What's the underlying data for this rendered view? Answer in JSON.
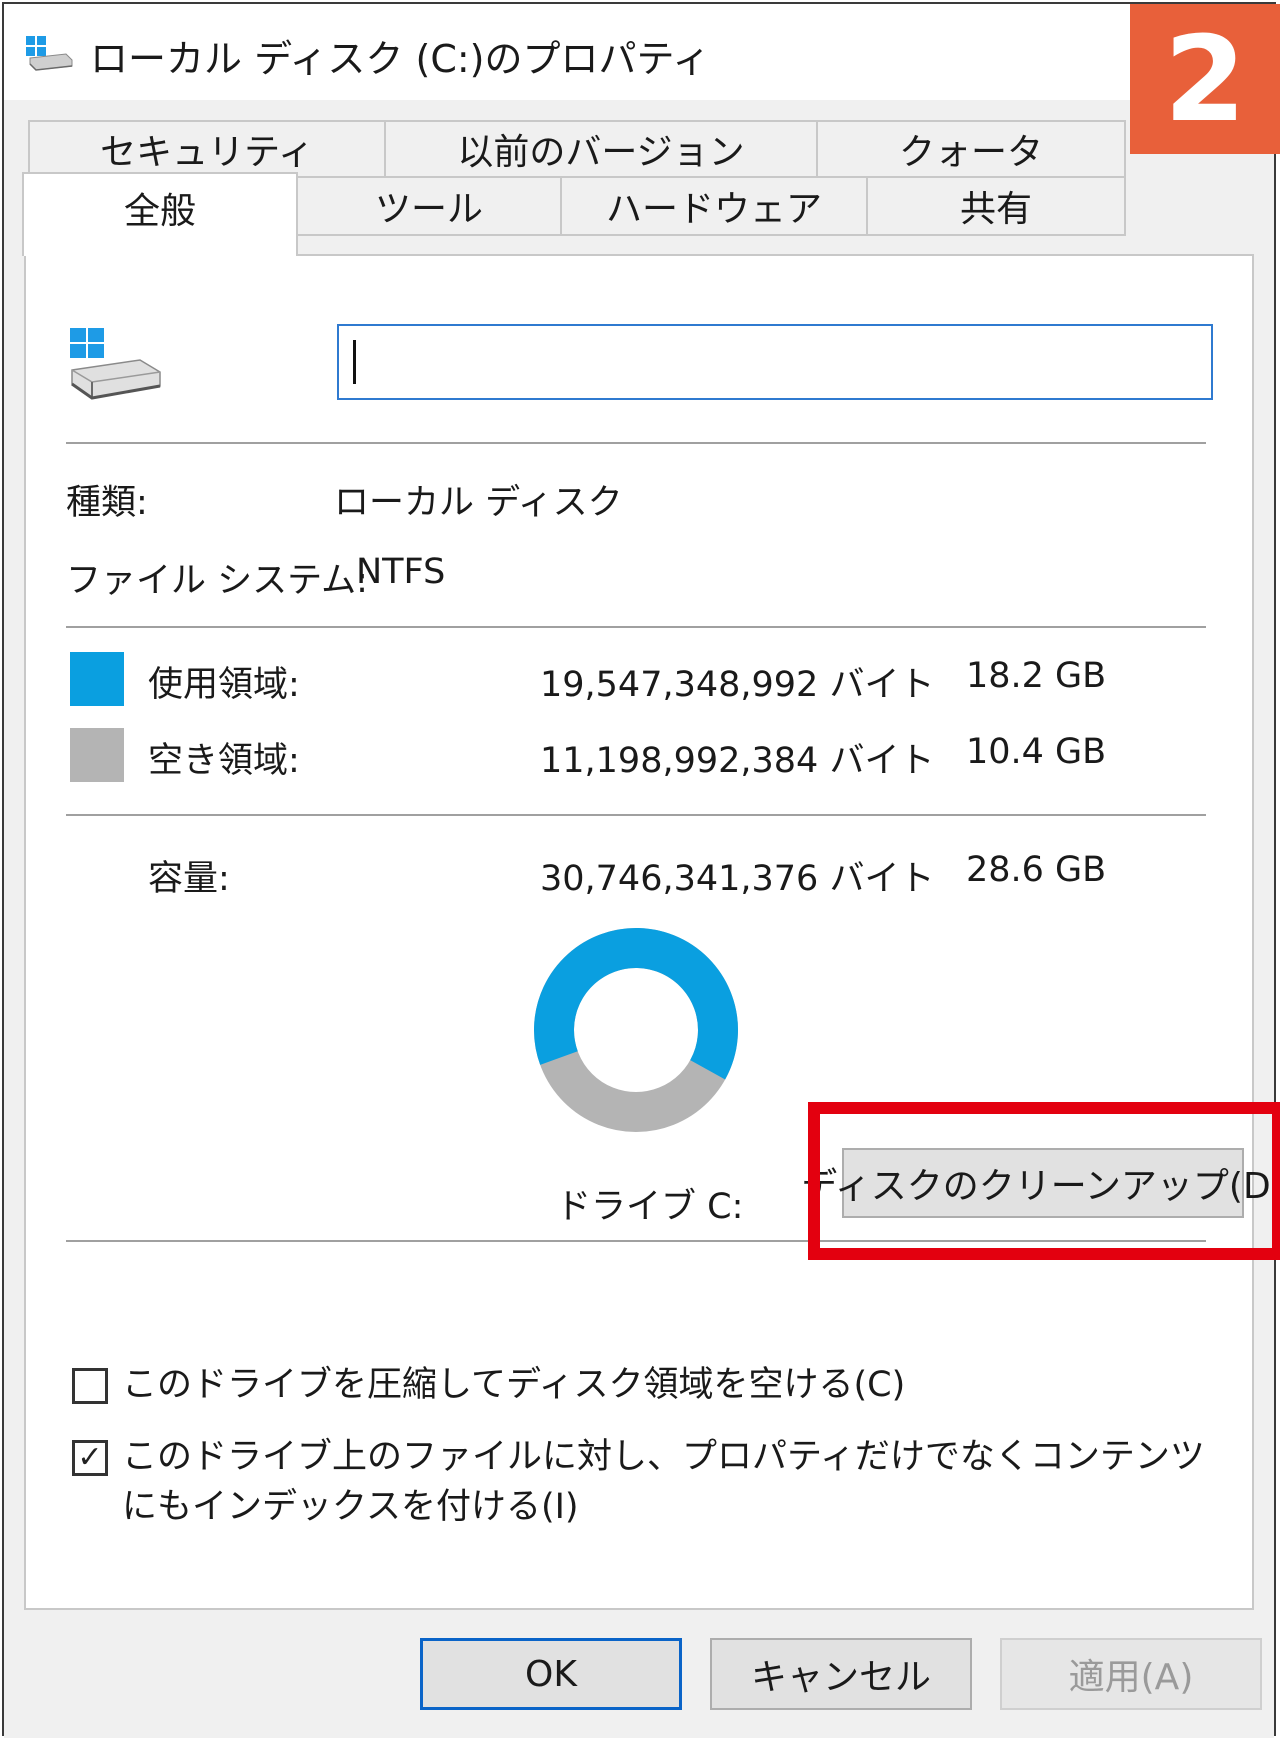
{
  "window": {
    "title": "ローカル ディスク (C:)のプロパティ",
    "step_badge": "2"
  },
  "tabs": {
    "row1": [
      "セキュリティ",
      "以前のバージョン",
      "クォータ"
    ],
    "row2": [
      "全般",
      "ツール",
      "ハードウェア",
      "共有"
    ],
    "active": "全般"
  },
  "general": {
    "drive_name_value": "",
    "type_label": "種類:",
    "type_value": "ローカル ディスク",
    "fs_label": "ファイル システム:",
    "fs_value": "NTFS",
    "used": {
      "label": "使用領域:",
      "bytes": "19,547,348,992 バイト",
      "size": "18.2 GB",
      "color": "#0a9fe0"
    },
    "free": {
      "label": "空き領域:",
      "bytes": "11,198,992,384 バイト",
      "size": "10.4 GB",
      "color": "#b4b4b4"
    },
    "capacity": {
      "label": "容量:",
      "bytes": "30,746,341,376 バイト",
      "size": "28.6 GB"
    },
    "drive_label": "ドライブ C:",
    "cleanup_button": "ディスクのクリーンアップ(D)",
    "usage_fraction": 0.636
  },
  "options": {
    "compress": {
      "label": "このドライブを圧縮してディスク領域を空ける(C)",
      "checked": false
    },
    "index": {
      "label": "このドライブ上のファイルに対し、プロパティだけでなくコンテンツにもインデックスを付ける(I)",
      "checked": true
    }
  },
  "footer": {
    "ok": "OK",
    "cancel": "キャンセル",
    "apply": "適用(A)"
  }
}
